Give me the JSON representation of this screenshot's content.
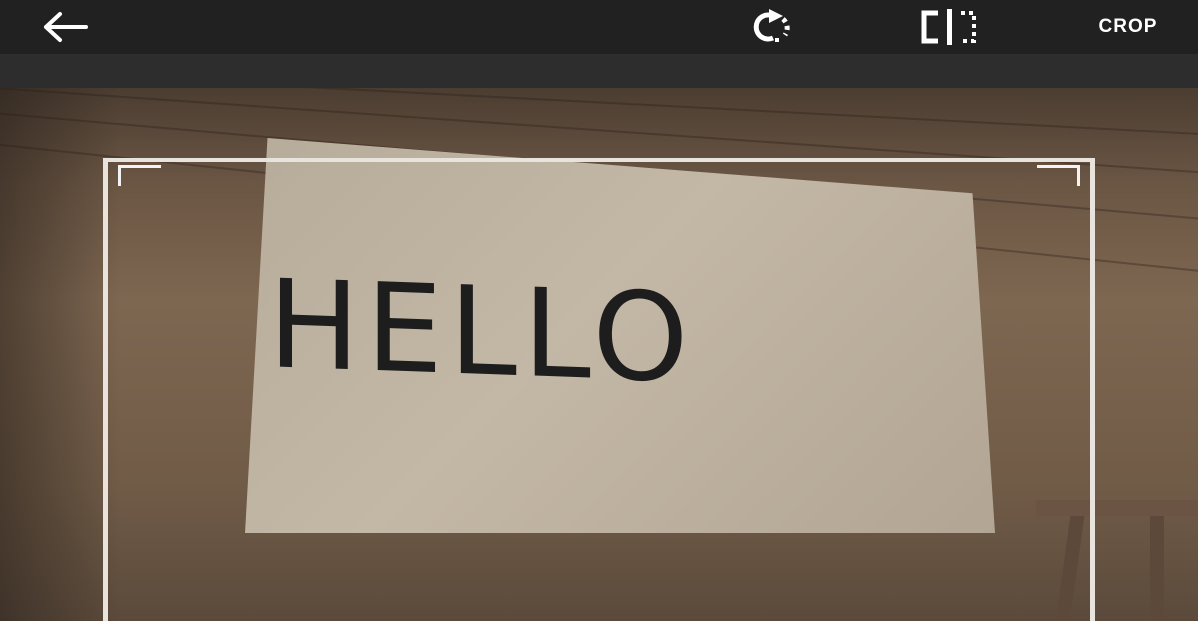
{
  "toolbar": {
    "back_icon": "arrow-left-icon",
    "rotate_icon": "rotate-icon",
    "flip_icon": "flip-horizontal-icon",
    "crop_label": "CROP"
  },
  "photo": {
    "sign_text": "HELLO"
  },
  "colors": {
    "toolbar_bg": "#212121",
    "icon_color": "#ffffff",
    "crop_frame": "#e8e3dc"
  }
}
